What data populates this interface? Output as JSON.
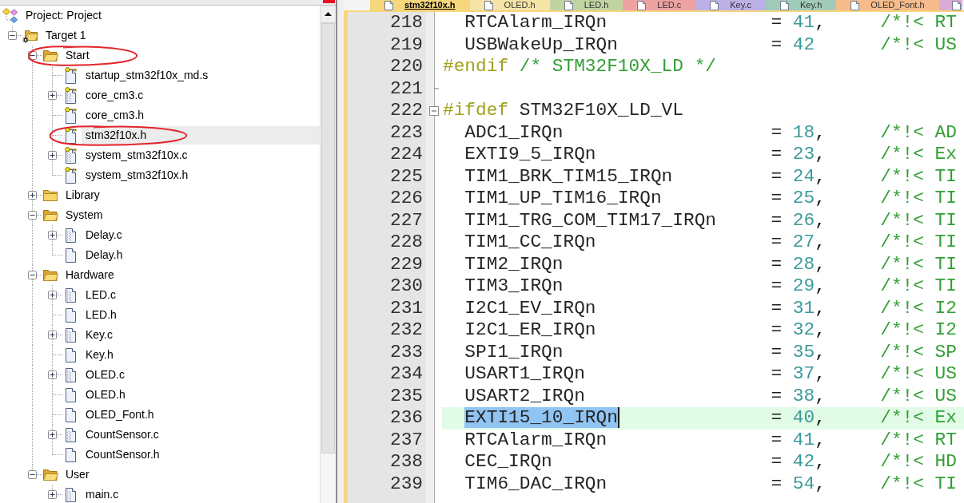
{
  "project_panel": {
    "tree": [
      {
        "label": "Project: Project",
        "kind": "project",
        "selected": false,
        "circled": false,
        "children": [
          {
            "label": "Target 1",
            "kind": "target",
            "expanded": true,
            "selected": false,
            "circled": false,
            "children": [
              {
                "label": "Start",
                "kind": "group",
                "expanded": true,
                "selected": false,
                "circled": true,
                "children": [
                  {
                    "label": "startup_stm32f10x_md.s",
                    "kind": "file",
                    "read_only": true,
                    "selected": false,
                    "circled": false
                  },
                  {
                    "label": "core_cm3.c",
                    "kind": "file",
                    "expanded": false,
                    "read_only": true,
                    "selected": false,
                    "circled": false
                  },
                  {
                    "label": "core_cm3.h",
                    "kind": "file",
                    "read_only": true,
                    "selected": false,
                    "circled": false
                  },
                  {
                    "label": "stm32f10x.h",
                    "kind": "file",
                    "read_only": true,
                    "selected": true,
                    "circled": true
                  },
                  {
                    "label": "system_stm32f10x.c",
                    "kind": "file",
                    "expanded": false,
                    "read_only": true,
                    "selected": false,
                    "circled": false
                  },
                  {
                    "label": "system_stm32f10x.h",
                    "kind": "file",
                    "read_only": true,
                    "selected": false,
                    "circled": false
                  }
                ]
              },
              {
                "label": "Library",
                "kind": "group",
                "expanded": false,
                "selected": false,
                "circled": false
              },
              {
                "label": "System",
                "kind": "group",
                "expanded": true,
                "selected": false,
                "circled": false,
                "children": [
                  {
                    "label": "Delay.c",
                    "kind": "file",
                    "expanded": false,
                    "read_only": false,
                    "selected": false,
                    "circled": false
                  },
                  {
                    "label": "Delay.h",
                    "kind": "file",
                    "read_only": false,
                    "selected": false,
                    "circled": false
                  }
                ]
              },
              {
                "label": "Hardware",
                "kind": "group",
                "expanded": true,
                "selected": false,
                "circled": false,
                "children": [
                  {
                    "label": "LED.c",
                    "kind": "file",
                    "expanded": false,
                    "read_only": false,
                    "selected": false,
                    "circled": false
                  },
                  {
                    "label": "LED.h",
                    "kind": "file",
                    "read_only": false,
                    "selected": false,
                    "circled": false
                  },
                  {
                    "label": "Key.c",
                    "kind": "file",
                    "expanded": false,
                    "read_only": false,
                    "selected": false,
                    "circled": false
                  },
                  {
                    "label": "Key.h",
                    "kind": "file",
                    "read_only": false,
                    "selected": false,
                    "circled": false
                  },
                  {
                    "label": "OLED.c",
                    "kind": "file",
                    "expanded": false,
                    "read_only": false,
                    "selected": false,
                    "circled": false
                  },
                  {
                    "label": "OLED.h",
                    "kind": "file",
                    "read_only": false,
                    "selected": false,
                    "circled": false
                  },
                  {
                    "label": "OLED_Font.h",
                    "kind": "file",
                    "read_only": false,
                    "selected": false,
                    "circled": false
                  },
                  {
                    "label": "CountSensor.c",
                    "kind": "file",
                    "expanded": false,
                    "read_only": false,
                    "selected": false,
                    "circled": false
                  },
                  {
                    "label": "CountSensor.h",
                    "kind": "file",
                    "read_only": false,
                    "selected": false,
                    "circled": false
                  }
                ]
              },
              {
                "label": "User",
                "kind": "group",
                "expanded": true,
                "selected": false,
                "circled": false,
                "children": [
                  {
                    "label": "main.c",
                    "kind": "file",
                    "expanded": false,
                    "read_only": false,
                    "selected": false,
                    "circled": false
                  }
                ]
              }
            ]
          }
        ]
      }
    ]
  },
  "editor": {
    "tabs": [
      {
        "label": "stm32f10x.h",
        "selected": true,
        "color": "#f7d77c"
      },
      {
        "label": "OLED.h",
        "selected": false,
        "color": "#f6e4a6"
      },
      {
        "label": "LED.h",
        "selected": false,
        "color": "#c0d4a2"
      },
      {
        "label": "LED.c",
        "selected": false,
        "color": "#eea3a3"
      },
      {
        "label": "Key.c",
        "selected": false,
        "color": "#bdb0e6"
      },
      {
        "label": "Key.h",
        "selected": false,
        "color": "#a0cbb9"
      },
      {
        "label": "OLED_Font.h",
        "selected": false,
        "color": "#f7bb8c"
      },
      {
        "selected": false,
        "color": "#dcaad6"
      }
    ],
    "lines": [
      {
        "number": "218",
        "kind": "enumerator",
        "name": "RTCAlarm_IRQn",
        "operator": "=",
        "value": "41",
        "punctuation": ",",
        "comment": "/*!< RT",
        "current": false,
        "selected": false
      },
      {
        "number": "219",
        "kind": "enumerator",
        "name": "USBWakeUp_IRQn",
        "operator": "=",
        "value": "42",
        "comment": "/*!< US",
        "current": false,
        "selected": false
      },
      {
        "number": "220",
        "kind": "directive",
        "directive": "#endif",
        "comment": "/* STM32F10X_LD */",
        "current": false,
        "selected": false
      },
      {
        "number": "221",
        "kind": "blank",
        "fold": {
          "kind": "end"
        },
        "current": false,
        "selected": false
      },
      {
        "number": "222",
        "kind": "directive",
        "directive": "#ifdef",
        "argument": "STM32F10X_LD_VL",
        "fold": {
          "kind": "start",
          "expanded": true
        },
        "current": false,
        "selected": false
      },
      {
        "number": "223",
        "kind": "enumerator",
        "name": "ADC1_IRQn",
        "operator": "=",
        "value": "18",
        "punctuation": ",",
        "comment": "/*!< AD",
        "current": false,
        "selected": false
      },
      {
        "number": "224",
        "kind": "enumerator",
        "name": "EXTI9_5_IRQn",
        "operator": "=",
        "value": "23",
        "punctuation": ",",
        "comment": "/*!< Ex",
        "current": false,
        "selected": false
      },
      {
        "number": "225",
        "kind": "enumerator",
        "name": "TIM1_BRK_TIM15_IRQn",
        "operator": "=",
        "value": "24",
        "punctuation": ",",
        "comment": "/*!< TI",
        "current": false,
        "selected": false
      },
      {
        "number": "226",
        "kind": "enumerator",
        "name": "TIM1_UP_TIM16_IRQn",
        "operator": "=",
        "value": "25",
        "punctuation": ",",
        "comment": "/*!< TI",
        "current": false,
        "selected": false
      },
      {
        "number": "227",
        "kind": "enumerator",
        "name": "TIM1_TRG_COM_TIM17_IRQn",
        "operator": "=",
        "value": "26",
        "punctuation": ",",
        "comment": "/*!< TI",
        "current": false,
        "selected": false
      },
      {
        "number": "228",
        "kind": "enumerator",
        "name": "TIM1_CC_IRQn",
        "operator": "=",
        "value": "27",
        "punctuation": ",",
        "comment": "/*!< TI",
        "current": false,
        "selected": false
      },
      {
        "number": "229",
        "kind": "enumerator",
        "name": "TIM2_IRQn",
        "operator": "=",
        "value": "28",
        "punctuation": ",",
        "comment": "/*!< TI",
        "current": false,
        "selected": false
      },
      {
        "number": "230",
        "kind": "enumerator",
        "name": "TIM3_IRQn",
        "operator": "=",
        "value": "29",
        "punctuation": ",",
        "comment": "/*!< TI",
        "current": false,
        "selected": false
      },
      {
        "number": "231",
        "kind": "enumerator",
        "name": "I2C1_EV_IRQn",
        "operator": "=",
        "value": "31",
        "punctuation": ",",
        "comment": "/*!< I2",
        "current": false,
        "selected": false
      },
      {
        "number": "232",
        "kind": "enumerator",
        "name": "I2C1_ER_IRQn",
        "operator": "=",
        "value": "32",
        "punctuation": ",",
        "comment": "/*!< I2",
        "current": false,
        "selected": false
      },
      {
        "number": "233",
        "kind": "enumerator",
        "name": "SPI1_IRQn",
        "operator": "=",
        "value": "35",
        "punctuation": ",",
        "comment": "/*!< SP",
        "current": false,
        "selected": false
      },
      {
        "number": "234",
        "kind": "enumerator",
        "name": "USART1_IRQn",
        "operator": "=",
        "value": "37",
        "punctuation": ",",
        "comment": "/*!< US",
        "current": false,
        "selected": false
      },
      {
        "number": "235",
        "kind": "enumerator",
        "name": "USART2_IRQn",
        "operator": "=",
        "value": "38",
        "punctuation": ",",
        "comment": "/*!< US",
        "current": false,
        "selected": false
      },
      {
        "number": "236",
        "kind": "enumerator",
        "name": "EXTI15_10_IRQn",
        "operator": "=",
        "value": "40",
        "punctuation": ",",
        "comment": "/*!< Ex",
        "current": true,
        "selected": true
      },
      {
        "number": "237",
        "kind": "enumerator",
        "name": "RTCAlarm_IRQn",
        "operator": "=",
        "value": "41",
        "punctuation": ",",
        "comment": "/*!< RT",
        "current": false,
        "selected": false
      },
      {
        "number": "238",
        "kind": "enumerator",
        "name": "CEC_IRQn",
        "operator": "=",
        "value": "42",
        "punctuation": ",",
        "comment": "/*!< HD",
        "current": false,
        "selected": false
      },
      {
        "number": "239",
        "kind": "enumerator",
        "name": "TIM6_DAC_IRQn",
        "operator": "=",
        "value": "54",
        "punctuation": ",",
        "comment": "/*!< TI",
        "current": false,
        "selected": false
      }
    ]
  }
}
